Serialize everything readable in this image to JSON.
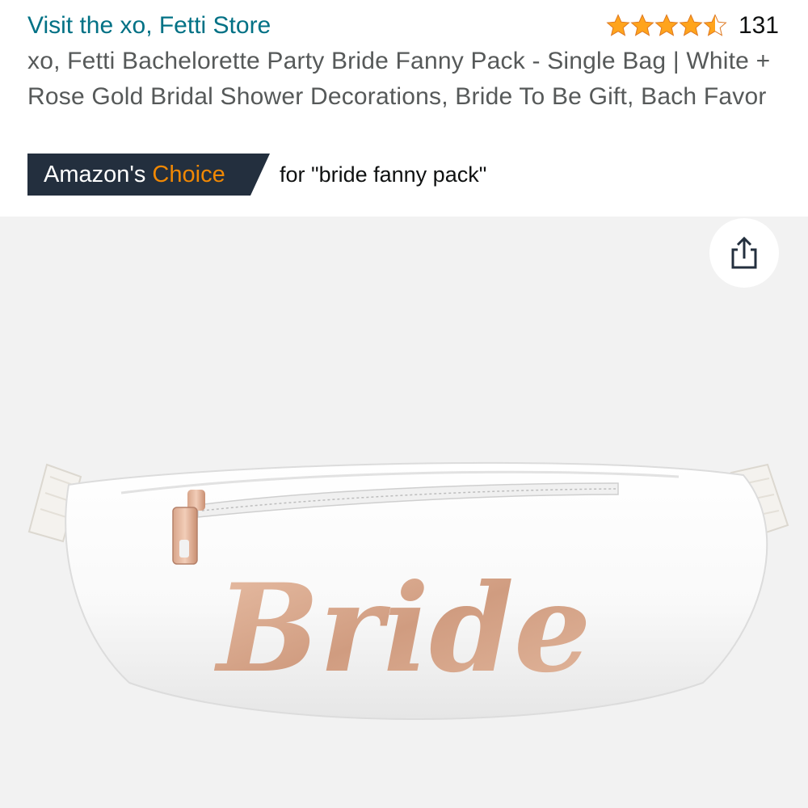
{
  "store": {
    "link_label": "Visit the xo, Fetti Store"
  },
  "rating": {
    "stars": 4.5,
    "max_stars": 5,
    "count": "131"
  },
  "product": {
    "title": "xo, Fetti Bachelorette Party Bride Fanny Pack - Single Bag | White + Rose Gold Bridal Shower Decorations, Bride To Be Gift, Bach Favor",
    "print_text": "Bride"
  },
  "badge": {
    "prefix": "Amazon's",
    "highlight": "Choice",
    "context": "for \"bride fanny pack\""
  },
  "icons": {
    "share": "share-icon",
    "star": "star-icon"
  },
  "colors": {
    "link": "#007185",
    "star": "#ffa41c",
    "badge_bg": "#232f3e",
    "badge_highlight": "#f08804",
    "image_bg": "#f2f2f2",
    "rose_gold": "#d9a98c"
  }
}
